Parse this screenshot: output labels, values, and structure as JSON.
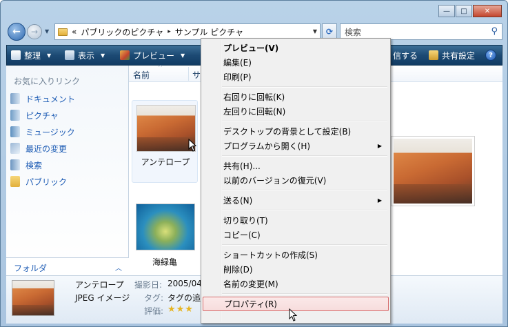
{
  "window": {
    "caption_buttons": [
      "—",
      "□",
      "✕"
    ]
  },
  "address": {
    "chevrons": "«",
    "crumb1": "パブリックのピクチャ",
    "separator": "▸",
    "crumb2": "サンプル ピクチャ",
    "search_placeholder": "検索"
  },
  "toolbar": {
    "organize": "整理",
    "view": "表示",
    "preview": "プレビュー",
    "share_partial": "信する",
    "share_settings": "共有設定",
    "help": "?"
  },
  "navpane": {
    "heading": "お気に入りリンク",
    "items": [
      {
        "label": "ドキュメント",
        "icon": "document-icon"
      },
      {
        "label": "ピクチャ",
        "icon": "pictures-icon"
      },
      {
        "label": "ミュージック",
        "icon": "music-icon"
      },
      {
        "label": "最近の変更",
        "icon": "recent-changes-icon"
      },
      {
        "label": "検索",
        "icon": "search-folder-icon"
      },
      {
        "label": "パブリック",
        "icon": "public-folder-icon"
      }
    ],
    "folders_label": "フォルダ",
    "folders_chevron": "︿"
  },
  "content": {
    "columns": [
      "名前",
      "サ"
    ],
    "files": [
      {
        "name": "アンテロープ",
        "image": "desert"
      },
      {
        "name": "海緑亀",
        "image": "sea"
      }
    ]
  },
  "details": {
    "name": "アンテロープ",
    "type": "JPEG イメージ",
    "date_label": "撮影日:",
    "date_value": "2005/04/",
    "tags_label": "タグ:",
    "tags_value": "タグの追",
    "rating_label": "評価:",
    "rating": "★★★"
  },
  "context_menu": {
    "items": [
      {
        "label": "プレビュー(V)",
        "bold": true,
        "submenu": false
      },
      {
        "label": "編集(E)",
        "submenu": false
      },
      {
        "label": "印刷(P)",
        "submenu": false
      },
      {
        "separator": true
      },
      {
        "label": "右回りに回転(K)",
        "submenu": false
      },
      {
        "label": "左回りに回転(N)",
        "submenu": false
      },
      {
        "separator": true
      },
      {
        "label": "デスクトップの背景として設定(B)",
        "submenu": false
      },
      {
        "label": "プログラムから開く(H)",
        "submenu": true
      },
      {
        "separator": true
      },
      {
        "label": "共有(H)...",
        "submenu": false
      },
      {
        "label": "以前のバージョンの復元(V)",
        "submenu": false
      },
      {
        "separator": true
      },
      {
        "label": "送る(N)",
        "submenu": true
      },
      {
        "separator": true
      },
      {
        "label": "切り取り(T)",
        "submenu": false
      },
      {
        "label": "コピー(C)",
        "submenu": false
      },
      {
        "separator": true
      },
      {
        "label": "ショートカットの作成(S)",
        "submenu": false
      },
      {
        "label": "削除(D)",
        "submenu": false
      },
      {
        "label": "名前の変更(M)",
        "submenu": false
      },
      {
        "separator": true
      },
      {
        "label": "プロパティ(R)",
        "submenu": false,
        "highlighted": true
      }
    ]
  }
}
